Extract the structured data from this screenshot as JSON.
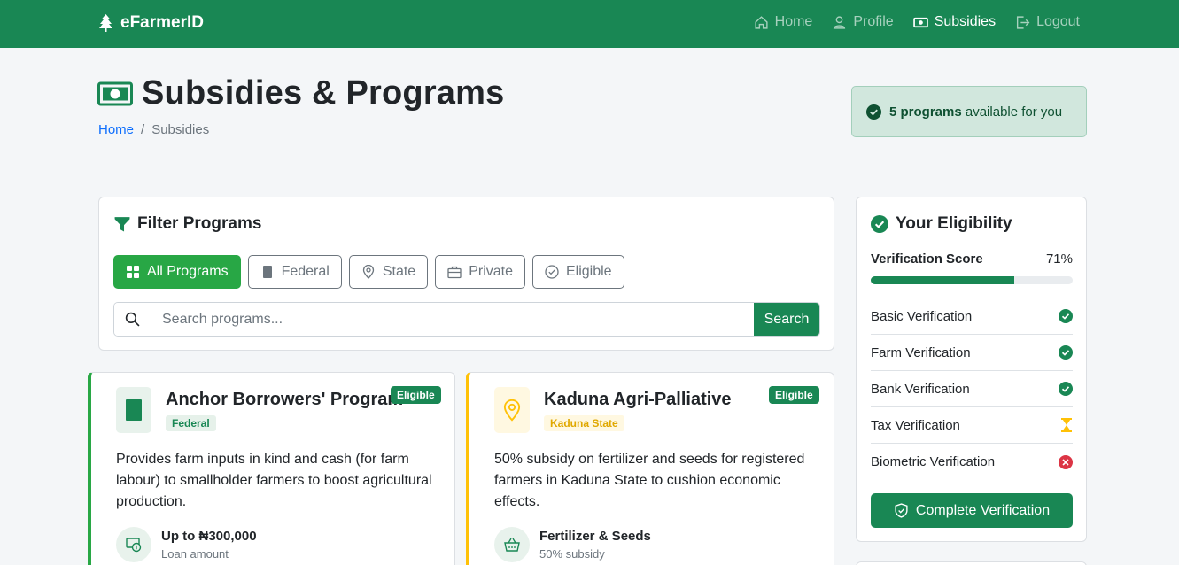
{
  "nav": {
    "brand": "eFarmerID",
    "links": [
      {
        "label": "Home",
        "icon": "home-icon",
        "active": false
      },
      {
        "label": "Profile",
        "icon": "person-icon",
        "active": false
      },
      {
        "label": "Subsidies",
        "icon": "cash-icon",
        "active": true
      },
      {
        "label": "Logout",
        "icon": "logout-icon",
        "active": false
      }
    ]
  },
  "header": {
    "title": "Subsidies & Programs",
    "breadcrumb_home": "Home",
    "breadcrumb_sep": "/",
    "breadcrumb_current": "Subsidies",
    "available_count": "5 programs",
    "available_suffix": "available for you"
  },
  "filter": {
    "heading": "Filter Programs",
    "buttons": [
      {
        "label": "All Programs",
        "icon": "grid-icon",
        "active": true
      },
      {
        "label": "Federal",
        "icon": "building-icon",
        "active": false
      },
      {
        "label": "State",
        "icon": "geo-pin-icon",
        "active": false
      },
      {
        "label": "Private",
        "icon": "briefcase-icon",
        "active": false
      },
      {
        "label": "Eligible",
        "icon": "check-circle-icon",
        "active": false
      }
    ],
    "search_placeholder": "Search programs...",
    "search_button": "Search"
  },
  "programs": [
    {
      "title": "Anchor Borrowers' Program",
      "tag": "Federal",
      "badge": "Eligible",
      "description": "Provides farm inputs in kind and cash (for farm labour) to smallholder farmers to boost agricultural production.",
      "benefit_value": "Up to ₦300,000",
      "benefit_label": "Loan amount",
      "accent": "#28a745"
    },
    {
      "title": "Kaduna Agri-Palliative",
      "tag": "Kaduna State",
      "badge": "Eligible",
      "description": "50% subsidy on fertilizer and seeds for registered farmers in Kaduna State to cushion economic effects.",
      "benefit_value": "Fertilizer & Seeds",
      "benefit_label": "50% subsidy",
      "accent": "#ffc107"
    }
  ],
  "eligibility": {
    "heading": "Your Eligibility",
    "score_label": "Verification Score",
    "score_text": "71%",
    "score_value": 0.71,
    "items": [
      {
        "label": "Basic Verification",
        "status": "verified"
      },
      {
        "label": "Farm Verification",
        "status": "verified"
      },
      {
        "label": "Bank Verification",
        "status": "verified"
      },
      {
        "label": "Tax Verification",
        "status": "pending"
      },
      {
        "label": "Biometric Verification",
        "status": "failed"
      }
    ],
    "button": "Complete Verification"
  },
  "colors": {
    "primary": "#198754",
    "success": "#28a745",
    "warning": "#ffc107",
    "danger": "#dc3545"
  }
}
